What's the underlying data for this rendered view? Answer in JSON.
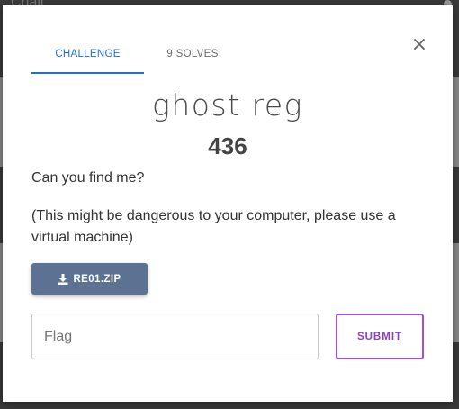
{
  "background": {
    "page_title": "Chall"
  },
  "modal": {
    "tabs": [
      {
        "label": "CHALLENGE",
        "active": true
      },
      {
        "label": "9 SOLVES",
        "active": false
      }
    ],
    "close_icon": "×",
    "challenge": {
      "name": "ghost reg",
      "points": "436",
      "description": [
        "Can you find me?",
        "(This might be dangerous to your computer, please use a virtual machine)"
      ],
      "file": {
        "label": "RE01.ZIP",
        "icon": "download-icon"
      }
    },
    "flag_input": {
      "placeholder": "Flag",
      "value": ""
    },
    "submit_label": "SUBMIT"
  },
  "colors": {
    "active_tab": "#1f6fcc",
    "download_button": "#5b7293",
    "submit_border": "#a24fd8"
  }
}
